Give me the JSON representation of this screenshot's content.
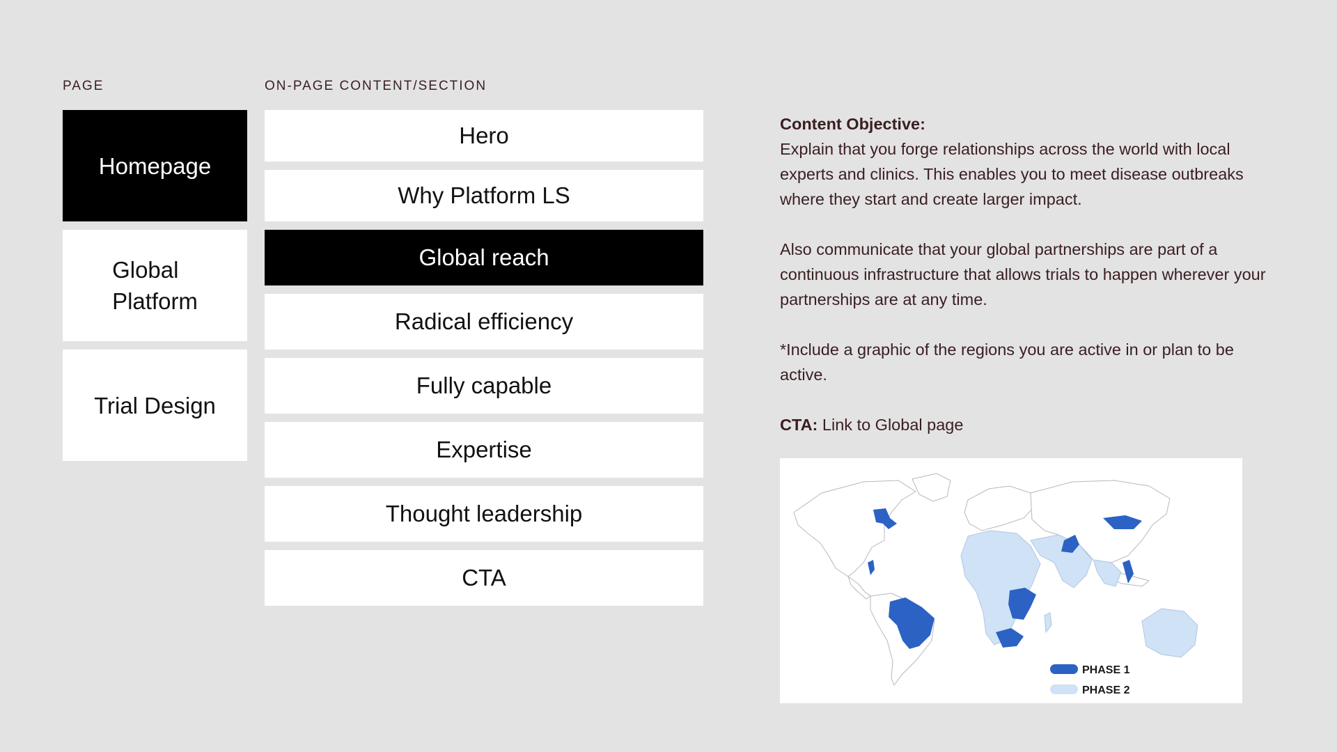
{
  "columns": {
    "page_heading": "PAGE",
    "section_heading": "ON-PAGE CONTENT/SECTION"
  },
  "pages": [
    {
      "label": "Homepage",
      "active": true
    },
    {
      "label": "Global\nPlatform",
      "active": false
    },
    {
      "label": "Trial Design",
      "active": false
    }
  ],
  "sections": [
    {
      "label": "Hero",
      "active": false
    },
    {
      "label": "Why Platform LS",
      "active": false
    },
    {
      "label": "Global reach",
      "active": true
    },
    {
      "label": "Radical efficiency",
      "active": false
    },
    {
      "label": "Fully capable",
      "active": false
    },
    {
      "label": "Expertise",
      "active": false
    },
    {
      "label": "Thought leadership",
      "active": false
    },
    {
      "label": "CTA",
      "active": false
    }
  ],
  "objective": {
    "heading": "Content Objective:",
    "para1": "Explain that you forge relationships across the world with local experts and clinics. This enables you to meet disease outbreaks where they start and create larger impact.",
    "para2": "Also communicate that your global partnerships are part of a continuous infrastructure that allows trials to happen wherever your partnerships are at any time.",
    "para3": "*Include a graphic of the regions you are active in or plan to be active.",
    "cta_label": "CTA:",
    "cta_text": " Link to Global page"
  },
  "map": {
    "legend": [
      {
        "label": "PHASE 1",
        "color": "#2b62c4"
      },
      {
        "label": "PHASE 2",
        "color": "#cfe2f6"
      }
    ]
  }
}
